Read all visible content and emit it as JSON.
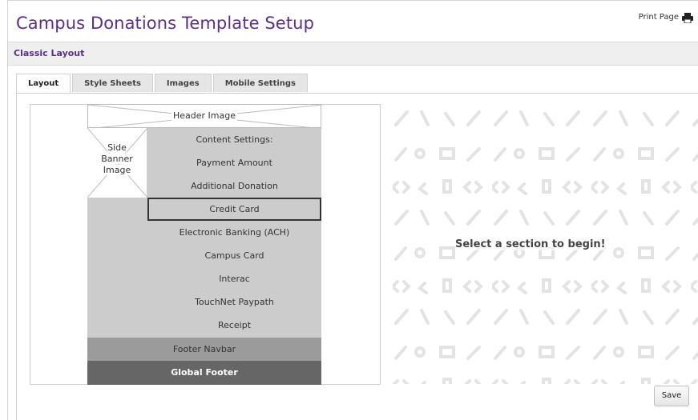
{
  "page": {
    "title": "Campus Donations Template Setup",
    "print_label": "Print Page"
  },
  "section": {
    "title": "Classic Layout"
  },
  "tabs": [
    {
      "label": "Layout",
      "active": true
    },
    {
      "label": "Style Sheets",
      "active": false
    },
    {
      "label": "Images",
      "active": false
    },
    {
      "label": "Mobile Settings",
      "active": false
    }
  ],
  "layout": {
    "header_image": "Header Image",
    "side_banner_line1": "Side",
    "side_banner_line2": "Banner",
    "side_banner_line3": "Image",
    "content_items": [
      "Content Settings:",
      "Payment Amount",
      "Additional Donation",
      "Credit Card",
      "Electronic Banking (ACH)",
      "Campus Card",
      "Interac",
      "TouchNet Paypath",
      "Receipt"
    ],
    "selected_item": "Credit Card",
    "footer_navbar": "Footer Navbar",
    "global_footer": "Global Footer"
  },
  "preview": {
    "message": "Select a section to begin!"
  },
  "buttons": {
    "save": "Save"
  },
  "colors": {
    "title": "#5b2f8a",
    "content_grey": "#cccccc",
    "footer_navbar": "#9b9b9b",
    "global_footer": "#666666"
  },
  "icons": {
    "print": "printer-icon"
  }
}
